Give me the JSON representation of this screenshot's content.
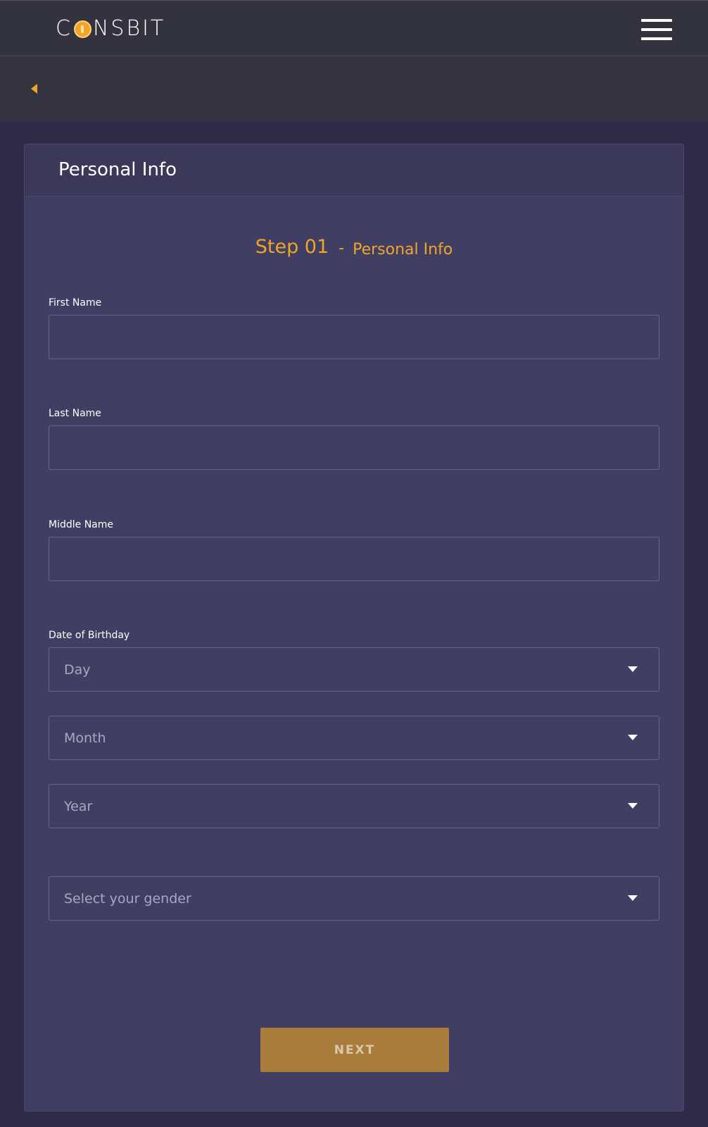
{
  "header": {
    "logo_text_before": "C",
    "logo_text_after": "NSBIT",
    "menu_icon": "hamburger-menu-icon",
    "back_icon": "back-arrow-icon"
  },
  "card": {
    "title": "Personal Info"
  },
  "step": {
    "number": "Step 01",
    "separator": "-",
    "name": "Personal Info"
  },
  "form": {
    "first_name_label": "First Name",
    "first_name_value": "",
    "last_name_label": "Last Name",
    "last_name_value": "",
    "middle_name_label": "Middle Name",
    "middle_name_value": "",
    "dob_label": "Date of Birthday",
    "day_placeholder": "Day",
    "month_placeholder": "Month",
    "year_placeholder": "Year",
    "gender_placeholder": "Select your gender",
    "next_label": "NEXT"
  },
  "colors": {
    "accent": "#f0a52a",
    "button": "#a97c3c",
    "card_bg": "#413e63",
    "page_bg": "#2f2b47",
    "topbar_bg": "#33323f"
  }
}
